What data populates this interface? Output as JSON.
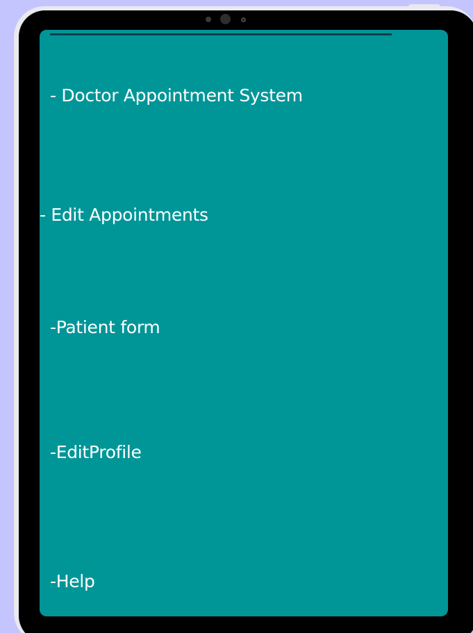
{
  "menu": {
    "items": [
      {
        "label": "- Doctor Appointment System"
      },
      {
        "label": "- Edit Appointments"
      },
      {
        "label": "-Patient form"
      },
      {
        "label": "-EditProfile"
      },
      {
        "label": "-Help"
      }
    ]
  },
  "colors": {
    "page_background": "#c4c4ff",
    "screen_background": "#009698",
    "text": "#ffffff",
    "bezel": "#000000"
  }
}
